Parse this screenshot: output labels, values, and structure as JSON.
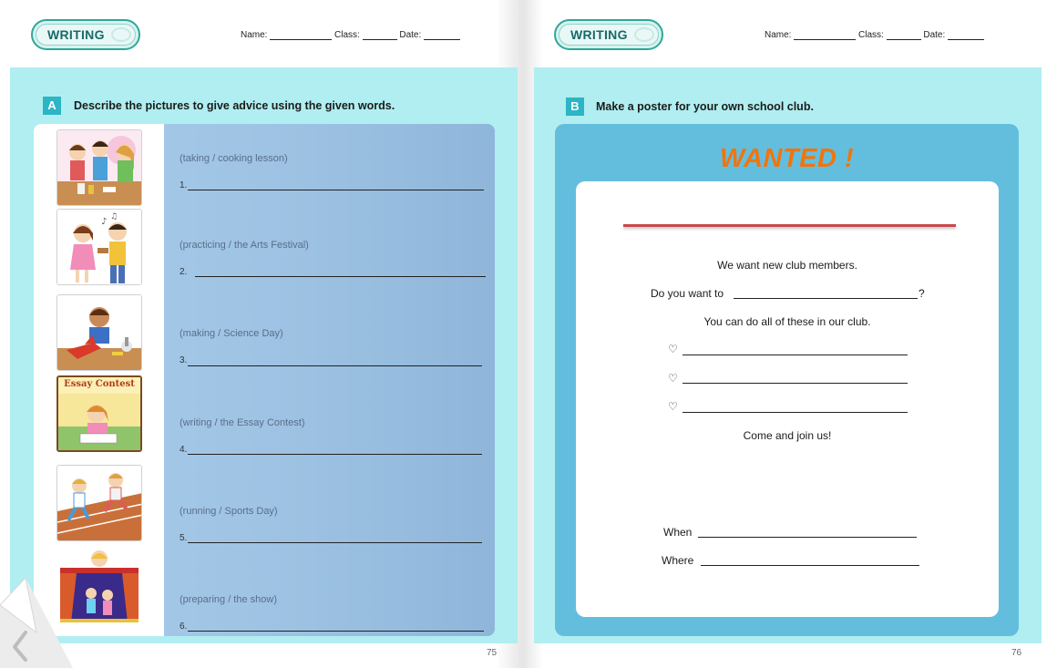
{
  "left_page": {
    "badge": "WRITING",
    "name_label": "Name:",
    "class_label": "Class:",
    "date_label": "Date:",
    "section_letter": "A",
    "section_title": "Describe the pictures to give advice using the given words.",
    "items": [
      {
        "hint": "(taking / cooking lesson)",
        "num": "1."
      },
      {
        "hint": "(practicing / the Arts Festival)",
        "num": "2."
      },
      {
        "hint": "(making / Science Day)",
        "num": "3."
      },
      {
        "hint": "(writing / the Essay Contest)",
        "num": "4."
      },
      {
        "hint": "(running / Sports Day)",
        "num": "5."
      },
      {
        "hint": "(preparing / the show)",
        "num": "6."
      }
    ],
    "essay_sign": "Essay Contest",
    "page_number": "75"
  },
  "right_page": {
    "badge": "WRITING",
    "name_label": "Name:",
    "class_label": "Class:",
    "date_label": "Date:",
    "section_letter": "B",
    "section_title": "Make a poster for your own school club.",
    "poster": {
      "heading": "WANTED !",
      "line1": "We want new club members.",
      "line2_prefix": "Do you want to",
      "line2_suffix": "?",
      "line3": "You can do all of these in our club.",
      "bullet": "♡",
      "line4": "Come and join us!",
      "when_label": "When",
      "where_label": "Where"
    },
    "page_number": "76"
  },
  "colors": {
    "teal_panel": "#b0eef1",
    "section_label": "#2cb5c4",
    "exercise_blue": "#9cc1e2",
    "poster_blue": "#63bede",
    "wanted_orange": "#f0750f",
    "rule_red": "#c9484a",
    "badge_green": "#2fa79a"
  },
  "icons": [
    "page-curl-back-icon",
    "heart-bullet-icon"
  ]
}
